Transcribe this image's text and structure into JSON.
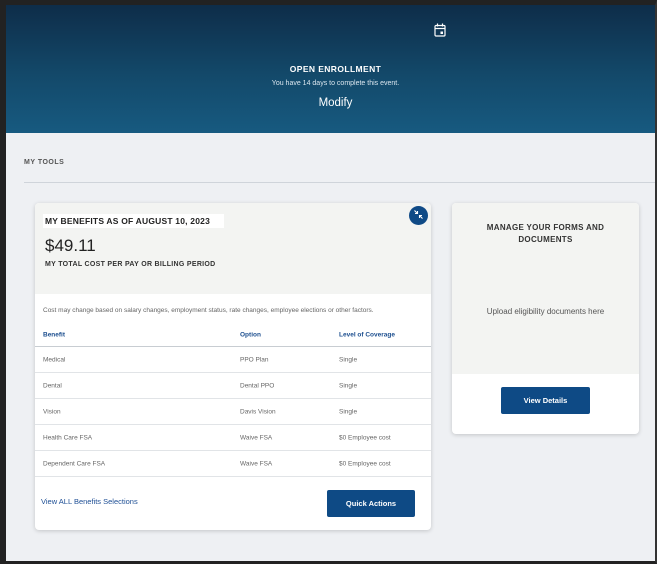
{
  "hero": {
    "icon": "calendar-icon",
    "title": "OPEN ENROLLMENT",
    "subtitle": "You have 14 days to complete this event.",
    "modify_label": "Modify",
    "colors": {
      "background_top": "#0e2d49",
      "background_bottom": "#175a80"
    }
  },
  "tools": {
    "section_label": "MY TOOLS"
  },
  "benefits_card": {
    "title": "MY BENEFITS AS OF AUGUST 10, 2023",
    "amount": "$49.11",
    "amount_label": "MY TOTAL COST PER PAY OR BILLING PERIOD",
    "collapse_icon": "collapse-arrows-icon",
    "note": "Cost may change based on salary changes, employment status, rate changes, employee elections or other factors.",
    "table": {
      "headers": [
        "Benefit",
        "Option",
        "Level of Coverage"
      ],
      "rows": [
        [
          "Medical",
          "PPO Plan",
          "Single"
        ],
        [
          "Dental",
          "Dental PPO",
          "Single"
        ],
        [
          "Vision",
          "Davis Vision",
          "Single"
        ],
        [
          "Health Care FSA",
          "Waive FSA",
          "$0 Employee cost"
        ],
        [
          "Dependent Care FSA",
          "Waive FSA",
          "$0 Employee cost"
        ]
      ]
    },
    "view_all_label": "View ALL Benefits Selections",
    "quick_actions_label": "Quick Actions"
  },
  "forms_card": {
    "title": "MANAGE YOUR FORMS AND DOCUMENTS",
    "text": "Upload eligibility documents here",
    "button_label": "View Details"
  },
  "colors": {
    "accent": "#0e4a85",
    "link": "#1e4f95",
    "header_link": "#1d4f8f"
  }
}
